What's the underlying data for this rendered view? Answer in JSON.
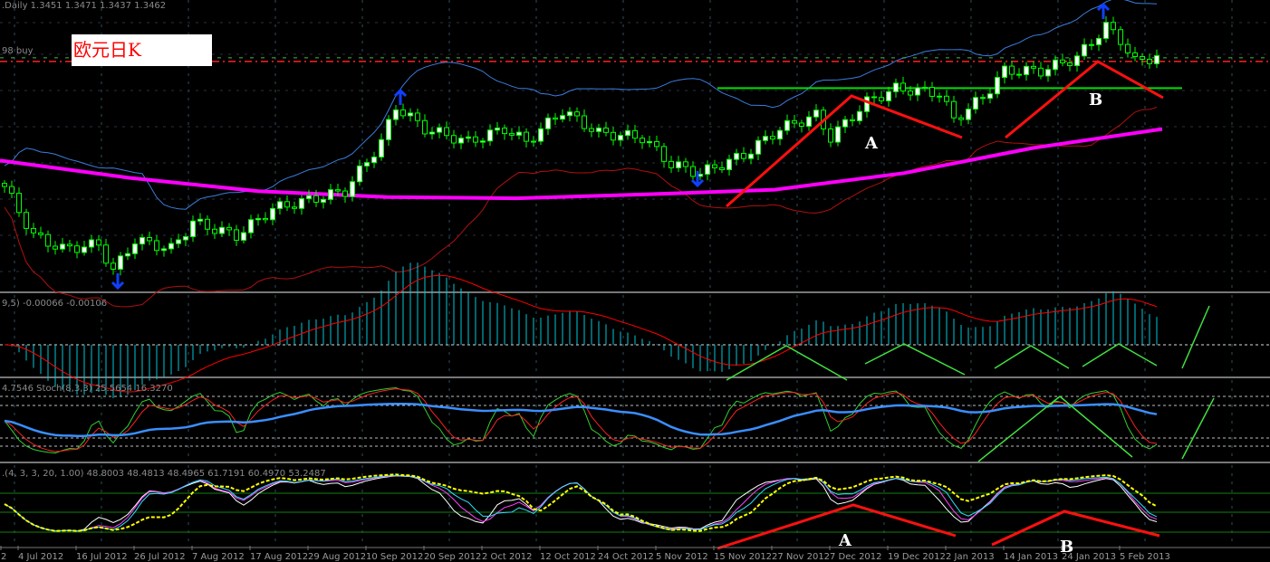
{
  "header": {
    "ohlc_text": ".Daily  1.3451 1.3471 1.3437 1.3462",
    "title_label": "欧元日K",
    "order_label": "98 buy"
  },
  "indicators": {
    "macd_label": "9,5) -0.00066 -0.00106",
    "stoch_label": "4.7546   Stoch(8,3,3) 25.5654 16.3270",
    "osc_label": ".(4, 3, 3, 20, 1.00) 48.8003 48.4813 48.4965 61.7191 60.4970 53.2487"
  },
  "annotations": {
    "a_main": "A",
    "b_main": "B",
    "a_osc": "A",
    "b_osc": "B"
  },
  "colors": {
    "bull": "#ffffff",
    "candle_outline": "#00ff00",
    "ma": "#ff00ff",
    "bb_upper": "#3b7ddd",
    "bb_lower": "#b01010",
    "macd_hist": "#00c8d8",
    "signal": "#ff0000",
    "trend": "#ff1010",
    "support": "#00e000",
    "arrow": "#1040ff"
  },
  "chart_data": {
    "type": "candlestick",
    "title": "EURUSD Daily",
    "xlabel": "",
    "ylabel": "",
    "ylim": [
      1.198,
      1.382
    ],
    "x_ticks": [
      "2",
      "4 Jul 2012",
      "16 Jul 2012",
      "26 Jul 2012",
      "7 Aug 2012",
      "17 Aug 2012",
      "29 Aug 2012",
      "10 Sep 2012",
      "20 Sep 2012",
      "2 Oct 2012",
      "12 Oct 2012",
      "24 Oct 2012",
      "5 Nov 2012",
      "15 Nov 2012",
      "27 Nov 2012",
      "7 Dec 2012",
      "19 Dec 2012",
      "2 Jan 2013",
      "14 Jan 2013",
      "24 Jan 2013",
      "5 Feb 2013"
    ],
    "key_closes": [
      1.2635,
      1.2323,
      1.2238,
      1.2267,
      1.2097,
      1.2295,
      1.2238,
      1.2408,
      1.2323,
      1.2493,
      1.255,
      1.2606,
      1.2918,
      1.3144,
      1.3002,
      1.2918,
      1.3002,
      1.2918,
      1.3116,
      1.2974,
      1.2946,
      1.2776,
      1.2719,
      1.2833,
      1.3002,
      1.3087,
      1.2946,
      1.3172,
      1.3257,
      1.3229,
      1.3059,
      1.3201,
      1.337,
      1.337,
      1.3455,
      1.3653,
      1.3568,
      1.3427,
      1.3462
    ],
    "key_bar_index": [
      0,
      4,
      8,
      13,
      15,
      18,
      23,
      26,
      32,
      37,
      42,
      47,
      52,
      54,
      58,
      64,
      69,
      72,
      77,
      82,
      88,
      92,
      96,
      102,
      107,
      112,
      114,
      119,
      123,
      129,
      131,
      135,
      138,
      143,
      148,
      152,
      154,
      156,
      159
    ],
    "ma_keys": [
      1.28,
      1.269,
      1.2605,
      1.2568,
      1.256,
      1.2585,
      1.2615,
      1.272,
      1.288,
      1.3
    ],
    "support_level": 1.326,
    "order_level": 1.343
  }
}
